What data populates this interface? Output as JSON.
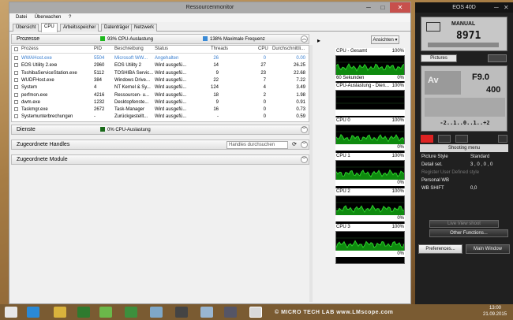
{
  "window": {
    "title": "Ressourcenmonitor"
  },
  "menu": [
    "Datei",
    "Überwachen",
    "?"
  ],
  "tabs": [
    "Übersicht",
    "CPU",
    "Arbeitsspeicher",
    "Datenträger",
    "Netzwerk"
  ],
  "sections": {
    "processes": {
      "label": "Prozesse",
      "cpu_status": "93% CPU-Auslastung",
      "freq_status": "138% Maximale Frequenz",
      "views_button": "Ansichten"
    },
    "services": {
      "label": "Dienste",
      "cpu_status": "0% CPU-Auslastung"
    },
    "handles": {
      "label": "Zugeordnete Handles",
      "search_placeholder": "Handles durchsuchen"
    },
    "modules": {
      "label": "Zugeordnete Module"
    }
  },
  "table": {
    "headers": [
      "Prozess",
      "PID",
      "Beschreibung",
      "Status",
      "Threads",
      "CPU",
      "Durchschnittli..."
    ],
    "rows": [
      [
        "WWAHost.exe",
        "5504",
        "Microsoft WW...",
        "Angehalten",
        "26",
        "0",
        "0.00"
      ],
      [
        "EOS Utility 2.exe",
        "2960",
        "EOS Utility 2",
        "Wird ausgefü...",
        "14",
        "27",
        "26.25"
      ],
      [
        "ToshibaServiceStation.exe",
        "5112",
        "TOSHIBA Servic...",
        "Wird ausgefü...",
        "9",
        "23",
        "22.68"
      ],
      [
        "WUDFHost.exe",
        "384",
        "Windows Drive...",
        "Wird ausgefü...",
        "22",
        "7",
        "7.22"
      ],
      [
        "System",
        "4",
        "NT Kernel & Sy...",
        "Wird ausgefü...",
        "124",
        "4",
        "3.49"
      ],
      [
        "perfmon.exe",
        "4216",
        "Ressourcen- u...",
        "Wird ausgefü...",
        "18",
        "2",
        "1.98"
      ],
      [
        "dwm.exe",
        "1232",
        "Desktopfenste...",
        "Wird ausgefü...",
        "9",
        "0",
        "0.91"
      ],
      [
        "Taskmgr.exe",
        "2672",
        "Task-Manager",
        "Wird ausgefü...",
        "16",
        "0",
        "0.73"
      ],
      [
        "Systemunterbrechungen",
        "-",
        "Zurückgestellt...",
        "Wird ausgefü...",
        "-",
        "0",
        "0.59"
      ]
    ]
  },
  "graphs": [
    {
      "label": "CPU - Gesamt",
      "max": "100%",
      "footer_left": "60 Sekunden",
      "footer_right": "0%"
    },
    {
      "label": "CPU-Auslastung - Dien...",
      "max": "100%",
      "footer_left": "",
      "footer_right": ""
    },
    {
      "label": "CPU 0",
      "max": "100%",
      "footer_left": "",
      "footer_right": "0%"
    },
    {
      "label": "CPU 1",
      "max": "100%",
      "footer_left": "",
      "footer_right": "0%"
    },
    {
      "label": "CPU 2",
      "max": "100%",
      "footer_left": "",
      "footer_right": "0%"
    },
    {
      "label": "CPU 3",
      "max": "100%",
      "footer_left": "",
      "footer_right": "0%"
    }
  ],
  "eos": {
    "title": "EOS 40D",
    "mode": "MANUAL",
    "shots": "8971",
    "picture_style_btn": "Pictures",
    "aperture": "F9.0",
    "iso": "400",
    "mode_dial": "Av",
    "exposure_scale": "-2..1..0..1..+2",
    "shooting_menu": "Shooting menu",
    "rows": [
      {
        "label": "Picture Style",
        "value": "Standard"
      },
      {
        "label": "Detail set.",
        "value": "3 , 0 , 0 , 0"
      },
      {
        "label": "Register User Defined style",
        "value": ""
      },
      {
        "label": "Personal WB",
        "value": ""
      },
      {
        "label": "WB SHIFT",
        "value": "0,0"
      }
    ],
    "live_view": "Live View shoot",
    "other_functions": "Other Functions...",
    "preferences": "Preferences...",
    "main_window": "Main Window"
  },
  "taskbar": {
    "time": "13:00",
    "date": "21.09.2015",
    "watermark": "© MICRO TECH LAB    www.LMscope.com"
  },
  "colors": {
    "graph_line": "#2bd22b",
    "graph_fill": "#0e8a0e",
    "cpu_status_square": "#1db81d",
    "freq_status_square": "#3a8ad6",
    "close_button": "#c7504c"
  }
}
